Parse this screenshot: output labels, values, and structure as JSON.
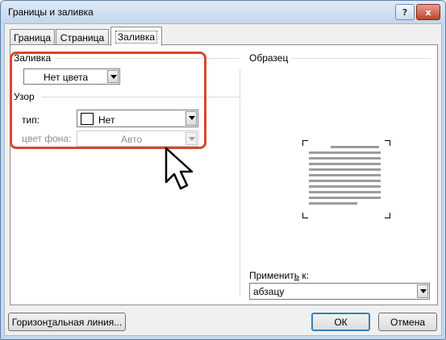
{
  "window": {
    "title": "Границы и заливка"
  },
  "titlebar": {
    "help_icon": "?",
    "close_icon": "x"
  },
  "tabs": [
    {
      "label": "Граница",
      "active": false
    },
    {
      "label": "Страница",
      "active": false
    },
    {
      "label": "Заливка",
      "active": true
    }
  ],
  "fill": {
    "group_label": "Заливка",
    "color_value": "Нет цвета"
  },
  "pattern": {
    "group_label": "Узор",
    "type_label": "тип:",
    "type_value": "Нет",
    "bg_color_label": "цвет фона:",
    "bg_color_value": "Авто"
  },
  "preview": {
    "label": "Образец"
  },
  "apply": {
    "label_pre": "Применит",
    "label_u": "ь",
    "label_post": " к:",
    "value": "абзацу"
  },
  "buttons": {
    "horizontal_line": {
      "pre": "Горизон",
      "u": "т",
      "post": "альная линия..."
    },
    "ok": "ОК",
    "cancel": "Отмена"
  },
  "colors": {
    "highlight": "#d9472b",
    "titlebar": "#c3d6ec",
    "close": "#c0422c"
  }
}
